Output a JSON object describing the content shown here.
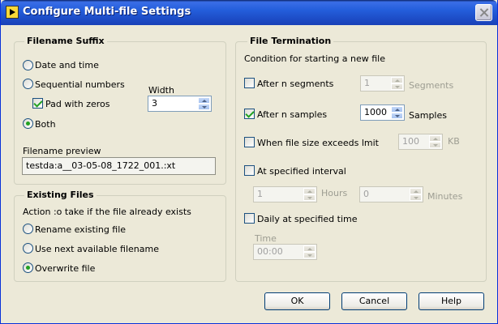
{
  "window": {
    "title": "Configure Multi-file Settings"
  },
  "filename_suffix": {
    "title": "Filename Suffix",
    "date_time_label": "Date and time",
    "sequential_label": "Sequential numbers",
    "width_label": "Width",
    "pad_label": "Pad with zeros",
    "width_value": "3",
    "both_label": "Both",
    "preview_label": "Filename preview",
    "preview_value": "testda:a__03-05-08_1722_001.:xt"
  },
  "existing_files": {
    "title": "Existing Files",
    "action_label": "Action :o take if the file already exists",
    "rename_label": "Rename existing file",
    "next_label": "Use next available filename",
    "overwrite_label": "Overwrite file"
  },
  "file_termination": {
    "title": "File Termination",
    "condition_label": "Condition for starting a new file",
    "after_segments_label": "After n segments",
    "segments_value": "1",
    "segments_unit": "Segments",
    "after_samples_label": "After n samples",
    "samples_value": "1000",
    "samples_unit": "Samples",
    "file_size_label": "When file size exceeds lmit",
    "size_value": "100",
    "size_unit": "KB",
    "interval_label": "At specified interval",
    "hours_value": "1",
    "hours_unit": "Hours",
    "minutes_value": "0",
    "minutes_unit": "Minutes",
    "daily_label": "Daily at specified time",
    "time_label": "Time",
    "time_value": "00:00"
  },
  "buttons": {
    "ok": "OK",
    "cancel": "Cancel",
    "help": "Help"
  }
}
